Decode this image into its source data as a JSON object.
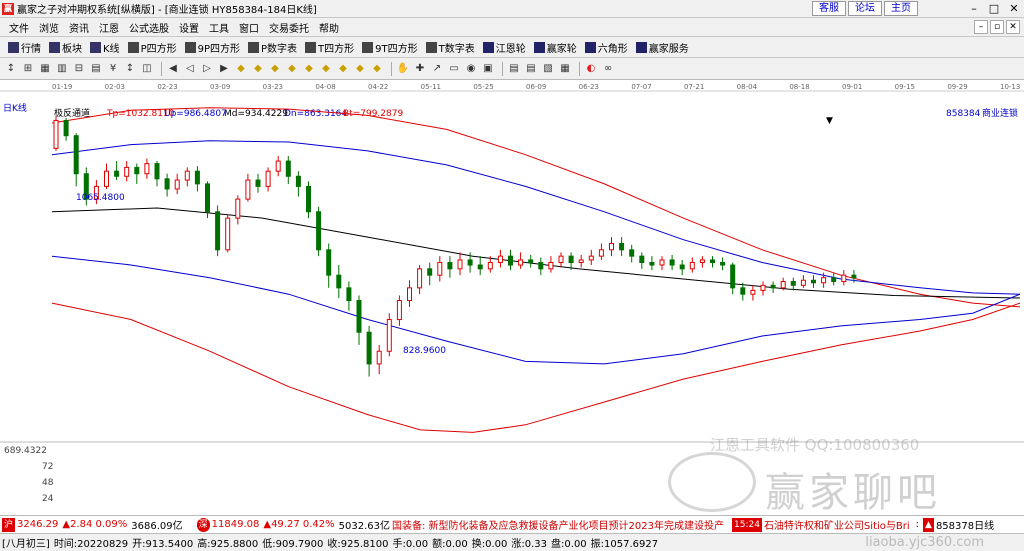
{
  "window": {
    "title": "赢家之子对冲期权系统[纵横版] - [商业连锁  HY858384-184日K线]",
    "links": [
      "客服",
      "论坛",
      "主页"
    ]
  },
  "menu": [
    "文件",
    "浏览",
    "资讯",
    "江恩",
    "公式选股",
    "设置",
    "工具",
    "窗口",
    "交易委托",
    "帮助"
  ],
  "funcbar": [
    {
      "label": "行情",
      "icon": "grid-icon",
      "color": "#336"
    },
    {
      "label": "板块",
      "icon": "blocks-icon",
      "color": "#336"
    },
    {
      "label": "K线",
      "icon": "candle-icon",
      "color": "#336"
    },
    {
      "label": "P四方形",
      "icon": "p-square-icon",
      "color": "#444"
    },
    {
      "label": "9P四方形",
      "icon": "9p-square-icon",
      "color": "#444"
    },
    {
      "label": "P数字表",
      "icon": "p-table-icon",
      "color": "#444"
    },
    {
      "label": "T四方形",
      "icon": "t-square-icon",
      "color": "#444"
    },
    {
      "label": "9T四方形",
      "icon": "9t-square-icon",
      "color": "#444"
    },
    {
      "label": "T数字表",
      "icon": "t-table-icon",
      "color": "#444"
    },
    {
      "label": "江恩轮",
      "icon": "wheel-icon",
      "color": "#226"
    },
    {
      "label": "赢家轮",
      "icon": "winner-wheel-icon",
      "color": "#226"
    },
    {
      "label": "六角形",
      "icon": "hexagon-icon",
      "color": "#226"
    },
    {
      "label": "赢家服务",
      "icon": "service-icon",
      "color": "#226"
    }
  ],
  "chart_header": {
    "period": "日K线",
    "indicator": "极反通道",
    "tp": "Tp=1032.8110",
    "up": "Up=986.4807",
    "md": "Md=934.4229",
    "dn": "Dn=863.3164",
    "bt": "Bt=799.2879",
    "code": "858384",
    "name": "商业连锁"
  },
  "dates": [
    "01-19",
    "02-03",
    "02-23",
    "03-09",
    "03-23",
    "04-08",
    "04-22",
    "05-11",
    "05-25",
    "06-09",
    "06-23",
    "07-07",
    "07-21",
    "08-04",
    "08-18",
    "09-01",
    "09-15",
    "09-29",
    "10-13"
  ],
  "y_labels": [
    "689.4322",
    "72",
    "48",
    "24"
  ],
  "annotations": {
    "high": "1065.4800",
    "low": "828.9600"
  },
  "colors": {
    "up": "#e00000",
    "down": "#007000",
    "red_band": "#e00000",
    "blue_band": "#0000d0",
    "mid": "#000000"
  },
  "status": {
    "sh_index": "3246.29",
    "sh_change": "▲2.84 0.09%",
    "sh_amount": "3686.09亿",
    "sz_index": "11849.08",
    "sz_change": "▲49.27 0.42%",
    "sz_amount": "5032.63亿",
    "news1": "国装备: 新型防化装备及应急救援设备产业化项目预计2023年完成建设投产",
    "news_time": "15:24",
    "news2": "石油特许权和矿业公司Sitio与Bri",
    "code_right": "858378日线"
  },
  "info": {
    "date_label": "[八月初三]",
    "time": "时间:20220829",
    "open": "开:913.5400",
    "high": "高:925.8800",
    "low": "低:909.7900",
    "close": "收:925.8100",
    "hand": "手:0.00",
    "amount": "额:0.00",
    "vol": "换:0.00",
    "rise": "涨:0.33",
    "pan": "盘:0.00",
    "last": "振:1057.6927"
  },
  "watermarks": {
    "brand": "江恩工具软件  QQ:100800360",
    "forum": "赢家聊吧",
    "url": "liaoba.yjc360.com"
  },
  "chart_data": {
    "type": "candlestick",
    "x_range": [
      0,
      184
    ],
    "y_range": [
      810,
      1075
    ],
    "series": [
      {
        "name": "Tp",
        "values": [
          [
            0,
            1060
          ],
          [
            15,
            1070
          ],
          [
            30,
            1072
          ],
          [
            45,
            1071
          ],
          [
            60,
            1066
          ],
          [
            75,
            1055
          ],
          [
            90,
            1035
          ],
          [
            105,
            1012
          ],
          [
            120,
            985
          ],
          [
            135,
            960
          ],
          [
            150,
            940
          ],
          [
            165,
            925
          ],
          [
            175,
            918
          ],
          [
            184,
            915
          ]
        ]
      },
      {
        "name": "Up",
        "values": [
          [
            0,
            1035
          ],
          [
            15,
            1043
          ],
          [
            30,
            1046
          ],
          [
            45,
            1045
          ],
          [
            60,
            1038
          ],
          [
            75,
            1027
          ],
          [
            90,
            1010
          ],
          [
            105,
            990
          ],
          [
            120,
            968
          ],
          [
            135,
            950
          ],
          [
            150,
            937
          ],
          [
            165,
            930
          ],
          [
            175,
            926
          ],
          [
            184,
            925
          ]
        ]
      },
      {
        "name": "Md",
        "values": [
          [
            0,
            990
          ],
          [
            20,
            993
          ],
          [
            40,
            985
          ],
          [
            60,
            970
          ],
          [
            80,
            955
          ],
          [
            100,
            945
          ],
          [
            120,
            937
          ],
          [
            140,
            929
          ],
          [
            160,
            924
          ],
          [
            184,
            922
          ]
        ]
      },
      {
        "name": "Dn",
        "values": [
          [
            0,
            955
          ],
          [
            15,
            948
          ],
          [
            30,
            938
          ],
          [
            45,
            925
          ],
          [
            60,
            905
          ],
          [
            75,
            888
          ],
          [
            90,
            872
          ],
          [
            105,
            870
          ],
          [
            120,
            878
          ],
          [
            135,
            892
          ],
          [
            150,
            900
          ],
          [
            165,
            905
          ],
          [
            175,
            910
          ],
          [
            184,
            925
          ]
        ]
      },
      {
        "name": "Bt",
        "values": [
          [
            0,
            918
          ],
          [
            15,
            905
          ],
          [
            30,
            880
          ],
          [
            45,
            852
          ],
          [
            60,
            830
          ],
          [
            70,
            818
          ],
          [
            80,
            816
          ],
          [
            90,
            822
          ],
          [
            105,
            840
          ],
          [
            120,
            858
          ],
          [
            135,
            872
          ],
          [
            150,
            885
          ],
          [
            165,
            896
          ],
          [
            175,
            905
          ],
          [
            184,
            918
          ]
        ]
      }
    ],
    "candles": [
      [
        1040,
        1062,
        1065,
        1038
      ],
      [
        1062,
        1050,
        1064,
        1046
      ],
      [
        1050,
        1020,
        1052,
        1010
      ],
      [
        1020,
        1000,
        1025,
        995
      ],
      [
        1000,
        1010,
        1015,
        996
      ],
      [
        1010,
        1022,
        1028,
        1008
      ],
      [
        1022,
        1018,
        1030,
        1015
      ],
      [
        1018,
        1025,
        1030,
        1014
      ],
      [
        1025,
        1020,
        1028,
        1012
      ],
      [
        1020,
        1028,
        1032,
        1016
      ],
      [
        1028,
        1016,
        1030,
        1010
      ],
      [
        1016,
        1008,
        1020,
        1002
      ],
      [
        1008,
        1015,
        1020,
        1004
      ],
      [
        1015,
        1022,
        1025,
        1010
      ],
      [
        1022,
        1012,
        1026,
        1006
      ],
      [
        1012,
        990,
        1014,
        985
      ],
      [
        990,
        960,
        995,
        955
      ],
      [
        960,
        985,
        988,
        958
      ],
      [
        985,
        1000,
        1003,
        980
      ],
      [
        1000,
        1015,
        1020,
        998
      ],
      [
        1015,
        1010,
        1020,
        1005
      ],
      [
        1010,
        1022,
        1025,
        1006
      ],
      [
        1022,
        1030,
        1034,
        1018
      ],
      [
        1030,
        1018,
        1034,
        1012
      ],
      [
        1018,
        1010,
        1022,
        1002
      ],
      [
        1010,
        990,
        1014,
        985
      ],
      [
        990,
        960,
        994,
        955
      ],
      [
        960,
        940,
        965,
        930
      ],
      [
        940,
        930,
        948,
        922
      ],
      [
        930,
        920,
        935,
        912
      ],
      [
        920,
        895,
        924,
        885
      ],
      [
        895,
        870,
        900,
        860
      ],
      [
        870,
        880,
        885,
        862
      ],
      [
        880,
        905,
        910,
        876
      ],
      [
        905,
        920,
        924,
        900
      ],
      [
        920,
        930,
        936,
        915
      ],
      [
        930,
        945,
        948,
        925
      ],
      [
        945,
        940,
        950,
        932
      ],
      [
        940,
        950,
        955,
        935
      ],
      [
        950,
        945,
        955,
        938
      ],
      [
        945,
        952,
        958,
        940
      ],
      [
        952,
        948,
        958,
        942
      ],
      [
        948,
        945,
        955,
        940
      ],
      [
        945,
        950,
        955,
        942
      ],
      [
        950,
        955,
        960,
        946
      ],
      [
        955,
        948,
        960,
        944
      ],
      [
        948,
        952,
        958,
        945
      ],
      [
        952,
        950,
        956,
        946
      ],
      [
        950,
        945,
        954,
        940
      ],
      [
        945,
        950,
        955,
        942
      ],
      [
        950,
        955,
        958,
        946
      ],
      [
        955,
        950,
        958,
        944
      ],
      [
        950,
        952,
        956,
        946
      ],
      [
        952,
        955,
        960,
        948
      ],
      [
        955,
        960,
        965,
        952
      ],
      [
        960,
        965,
        970,
        955
      ],
      [
        965,
        960,
        970,
        955
      ],
      [
        960,
        955,
        964,
        950
      ],
      [
        955,
        950,
        958,
        945
      ],
      [
        950,
        948,
        955,
        944
      ],
      [
        948,
        952,
        955,
        944
      ],
      [
        952,
        948,
        956,
        944
      ],
      [
        948,
        945,
        952,
        940
      ],
      [
        945,
        950,
        954,
        942
      ],
      [
        950,
        952,
        955,
        946
      ],
      [
        952,
        950,
        955,
        946
      ],
      [
        950,
        948,
        954,
        944
      ],
      [
        948,
        930,
        950,
        925
      ],
      [
        930,
        925,
        934,
        920
      ],
      [
        925,
        928,
        932,
        920
      ],
      [
        928,
        932,
        935,
        924
      ],
      [
        932,
        930,
        935,
        926
      ],
      [
        930,
        935,
        938,
        928
      ],
      [
        935,
        932,
        938,
        928
      ],
      [
        932,
        936,
        940,
        930
      ],
      [
        936,
        934,
        940,
        930
      ],
      [
        934,
        938,
        942,
        930
      ],
      [
        938,
        935,
        942,
        932
      ],
      [
        935,
        940,
        944,
        932
      ],
      [
        940,
        938,
        944,
        934
      ]
    ]
  }
}
